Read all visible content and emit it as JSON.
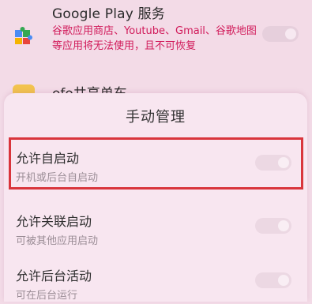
{
  "background_list": {
    "google_play": {
      "title": "Google Play 服务",
      "description": "谷歌应用商店、Youtube、Gmail、谷歌地图等应用将无法使用，且不可恢复",
      "icon": "puzzle-icon"
    },
    "next_app": {
      "title": "ofo共享单车",
      "icon": "app-icon"
    }
  },
  "sheet": {
    "title": "手动管理",
    "options": [
      {
        "label": "允许自启动",
        "sub": "开机或后台自启动",
        "enabled": false
      },
      {
        "label": "允许关联启动",
        "sub": "可被其他应用启动",
        "enabled": false
      },
      {
        "label": "允许后台活动",
        "sub": "可在后台运行",
        "enabled": false
      }
    ]
  },
  "colors": {
    "warning_text": "#d11a5a",
    "highlight": "#d9353c",
    "background": "#f3dbe7",
    "sheet": "#f8e6f0"
  }
}
